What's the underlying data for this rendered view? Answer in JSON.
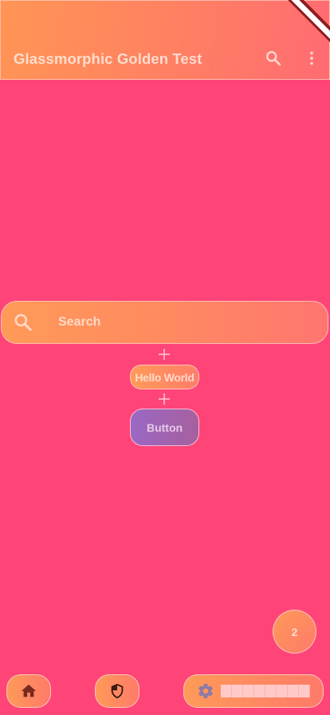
{
  "app_bar": {
    "title": "Glassmorphic Golden Test",
    "actions": [
      {
        "icon": "search-icon"
      },
      {
        "icon": "more-vert-icon"
      }
    ]
  },
  "search": {
    "placeholder": "Search",
    "icon": "search-icon"
  },
  "chip": {
    "label": "Hello World"
  },
  "button": {
    "label": "Button"
  },
  "fab": {
    "label": "2"
  },
  "bottom_nav": {
    "items": [
      {
        "icon": "home-icon"
      },
      {
        "icon": "shield-icon"
      },
      {
        "icon": "gear-icon"
      }
    ]
  },
  "colors": {
    "background": "#ff4478",
    "accent_orange": "#ff9a58",
    "button_purple": "#9a68c4",
    "banner_red": "#8f1c22"
  }
}
